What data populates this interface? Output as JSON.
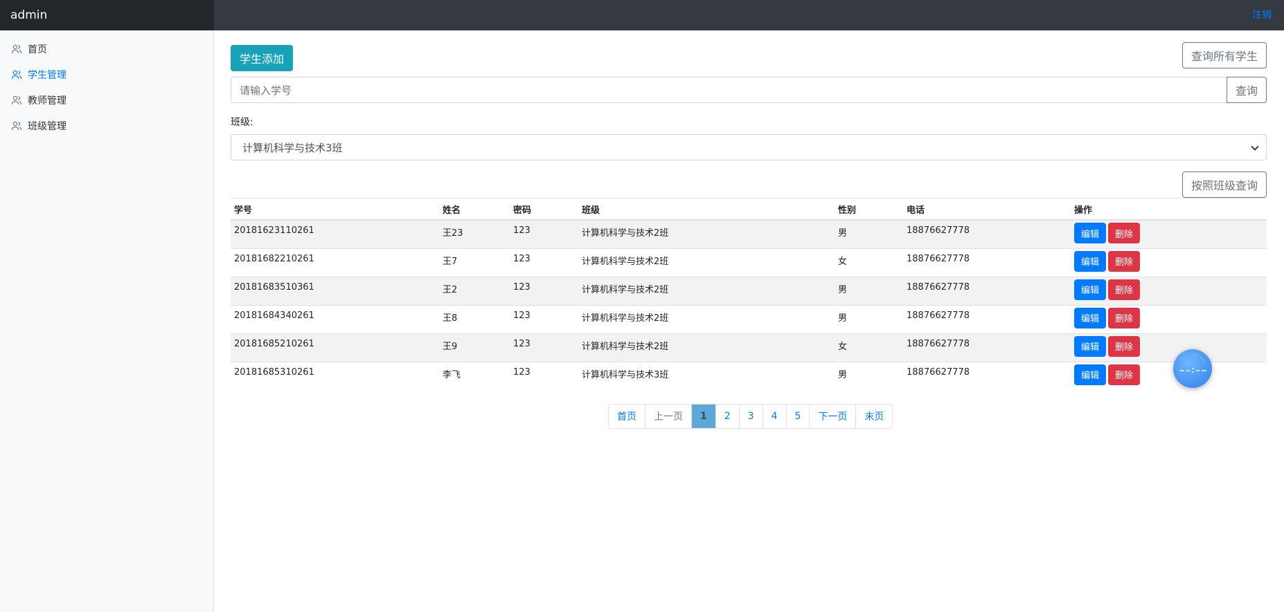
{
  "header": {
    "brand": "admin",
    "logout_label": "注销"
  },
  "sidebar": {
    "items": [
      {
        "label": "首页",
        "icon": "users-icon",
        "active": false
      },
      {
        "label": "学生管理",
        "icon": "users-icon",
        "active": true
      },
      {
        "label": "教师管理",
        "icon": "users-icon",
        "active": false
      },
      {
        "label": "班级管理",
        "icon": "users-icon",
        "active": false
      }
    ]
  },
  "toolbar": {
    "add_label": "学生添加",
    "query_all_label": "查询所有学生",
    "search_placeholder": "请输入学号",
    "search_label": "查询",
    "class_label": "班级:",
    "class_selected": "计算机科学与技术3班",
    "query_by_class_label": "按照班级查询"
  },
  "table": {
    "headers": [
      "学号",
      "姓名",
      "密码",
      "班级",
      "性别",
      "电话",
      "操作"
    ],
    "rows": [
      {
        "id": "20181623110261",
        "name": "王23",
        "password": "123",
        "class": "计算机科学与技术2班",
        "gender": "男",
        "phone": "18876627778"
      },
      {
        "id": "20181682210261",
        "name": "王7",
        "password": "123",
        "class": "计算机科学与技术2班",
        "gender": "女",
        "phone": "18876627778"
      },
      {
        "id": "20181683510361",
        "name": "王2",
        "password": "123",
        "class": "计算机科学与技术2班",
        "gender": "男",
        "phone": "18876627778"
      },
      {
        "id": "20181684340261",
        "name": "王8",
        "password": "123",
        "class": "计算机科学与技术2班",
        "gender": "男",
        "phone": "18876627778"
      },
      {
        "id": "20181685210261",
        "name": "王9",
        "password": "123",
        "class": "计算机科学与技术2班",
        "gender": "女",
        "phone": "18876627778"
      },
      {
        "id": "20181685310261",
        "name": "李飞",
        "password": "123",
        "class": "计算机科学与技术3班",
        "gender": "男",
        "phone": "18876627778"
      }
    ],
    "edit_label": "编辑",
    "delete_label": "删除"
  },
  "pagination": {
    "first": "首页",
    "prev": "上一页",
    "pages": [
      "1",
      "2",
      "3",
      "4",
      "5"
    ],
    "current": "1",
    "next": "下一页",
    "last": "末页"
  },
  "colors": {
    "topbar": "#343a40",
    "brand_bg": "#23272b",
    "accent": "#007bff",
    "info": "#17a2b8",
    "danger": "#dc3545",
    "active_page": "#5fa8d3"
  }
}
